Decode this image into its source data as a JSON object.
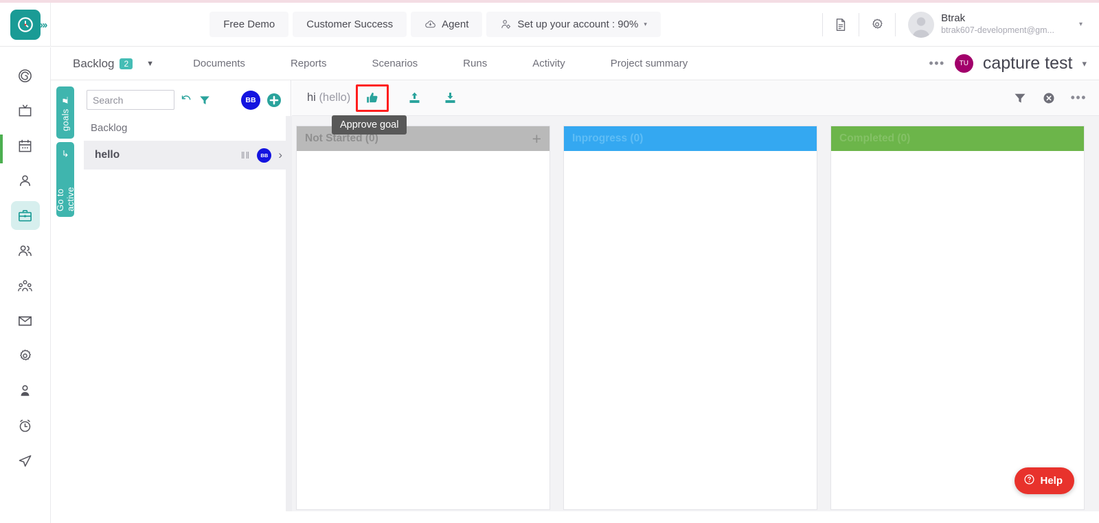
{
  "header": {
    "logo_icon": "clock-logo-icon",
    "expand_icon": "chevrons-right-icon",
    "buttons": [
      {
        "label": "Free Demo",
        "name": "free-demo-button"
      },
      {
        "label": "Customer Success",
        "name": "customer-success-button"
      },
      {
        "label": "Agent",
        "name": "agent-button",
        "icon": "agent-cloud-icon"
      },
      {
        "label": "Set up your account : 90%",
        "name": "setup-account-button",
        "icon": "user-gear-icon",
        "caret": "▾"
      }
    ],
    "doc_icon": "document-icon",
    "gear_icon": "gear-icon",
    "user": {
      "name": "Btrak",
      "email": "btrak607-development@gm...",
      "avatar_icon": "user-avatar-icon",
      "caret": "▾"
    }
  },
  "rail": {
    "items": [
      {
        "name": "sidebar-item-dashboard",
        "icon": "target-spiral-icon",
        "active": false
      },
      {
        "name": "sidebar-item-tv",
        "icon": "tv-icon",
        "active": false
      },
      {
        "name": "sidebar-item-calendar",
        "icon": "calendar-icon",
        "active": false
      },
      {
        "name": "sidebar-item-profile",
        "icon": "user-icon",
        "active": false
      },
      {
        "name": "sidebar-item-projects",
        "icon": "briefcase-icon",
        "active": true
      },
      {
        "name": "sidebar-item-team",
        "icon": "users-icon",
        "active": false
      },
      {
        "name": "sidebar-item-org",
        "icon": "org-people-icon",
        "active": false
      },
      {
        "name": "sidebar-item-mail",
        "icon": "envelope-icon",
        "active": false
      },
      {
        "name": "sidebar-item-settings",
        "icon": "gear-icon",
        "active": false
      },
      {
        "name": "sidebar-item-account",
        "icon": "person-filled-icon",
        "active": false
      },
      {
        "name": "sidebar-item-timer",
        "icon": "alarm-clock-icon",
        "active": false
      },
      {
        "name": "sidebar-item-send",
        "icon": "paper-plane-icon",
        "active": false
      }
    ]
  },
  "side_tabs": {
    "goals": {
      "label": "goals",
      "icon": "pin-icon"
    },
    "go_to_active": {
      "label": "Go to active",
      "icon": "arrow-curve-icon"
    }
  },
  "tabbar": {
    "backlog": {
      "label": "Backlog",
      "count": "2",
      "caret": "▼"
    },
    "tabs": [
      {
        "label": "Documents",
        "name": "tab-documents"
      },
      {
        "label": "Reports",
        "name": "tab-reports"
      },
      {
        "label": "Scenarios",
        "name": "tab-scenarios"
      },
      {
        "label": "Runs",
        "name": "tab-runs"
      },
      {
        "label": "Activity",
        "name": "tab-activity"
      },
      {
        "label": "Project summary",
        "name": "tab-project-summary"
      }
    ],
    "more_dots": "•••",
    "project_avatar": "TU",
    "project_name": "capture test",
    "project_caret": "▾"
  },
  "panel": {
    "search": {
      "placeholder": "Search",
      "value": ""
    },
    "refresh_icon": "refresh-icon",
    "filter_icon": "filter-icon",
    "avatar_initials": "BB",
    "add_icon": "add-circle-icon",
    "section_label": "Backlog",
    "rows": [
      {
        "label": "hello",
        "grip": "‖‖",
        "avatar": "BB",
        "chevron": "›"
      }
    ]
  },
  "board_toolbar": {
    "goal_title_main": "hi ",
    "goal_title_sub": "(hello)",
    "approve_icon": "thumbs-up-icon",
    "upload_icon": "upload-icon",
    "download_icon": "download-icon",
    "filter_icon": "filter-icon",
    "clear_icon": "clear-circle-icon",
    "more_icon": "more-horizontal-icon",
    "highlight_color": "#ff1d1d"
  },
  "tooltip": {
    "text": "Approve goal"
  },
  "board": {
    "columns": [
      {
        "title": "Not Started (0)",
        "name": "column-not-started",
        "bg": "#b9b9b9",
        "fg": "#8f8f8f",
        "has_plus": true,
        "plus": "+"
      },
      {
        "title": "Inprogress (0)",
        "name": "column-inprogress",
        "bg": "#34a8f1",
        "fg": "#5fbdf5",
        "has_plus": false,
        "plus": ""
      },
      {
        "title": "Completed (0)",
        "name": "column-completed",
        "bg": "#6cb54a",
        "fg": "#84c166",
        "has_plus": false,
        "plus": ""
      }
    ]
  },
  "help": {
    "label": "Help",
    "icon": "question-circle-icon",
    "color": "#e8322c"
  }
}
